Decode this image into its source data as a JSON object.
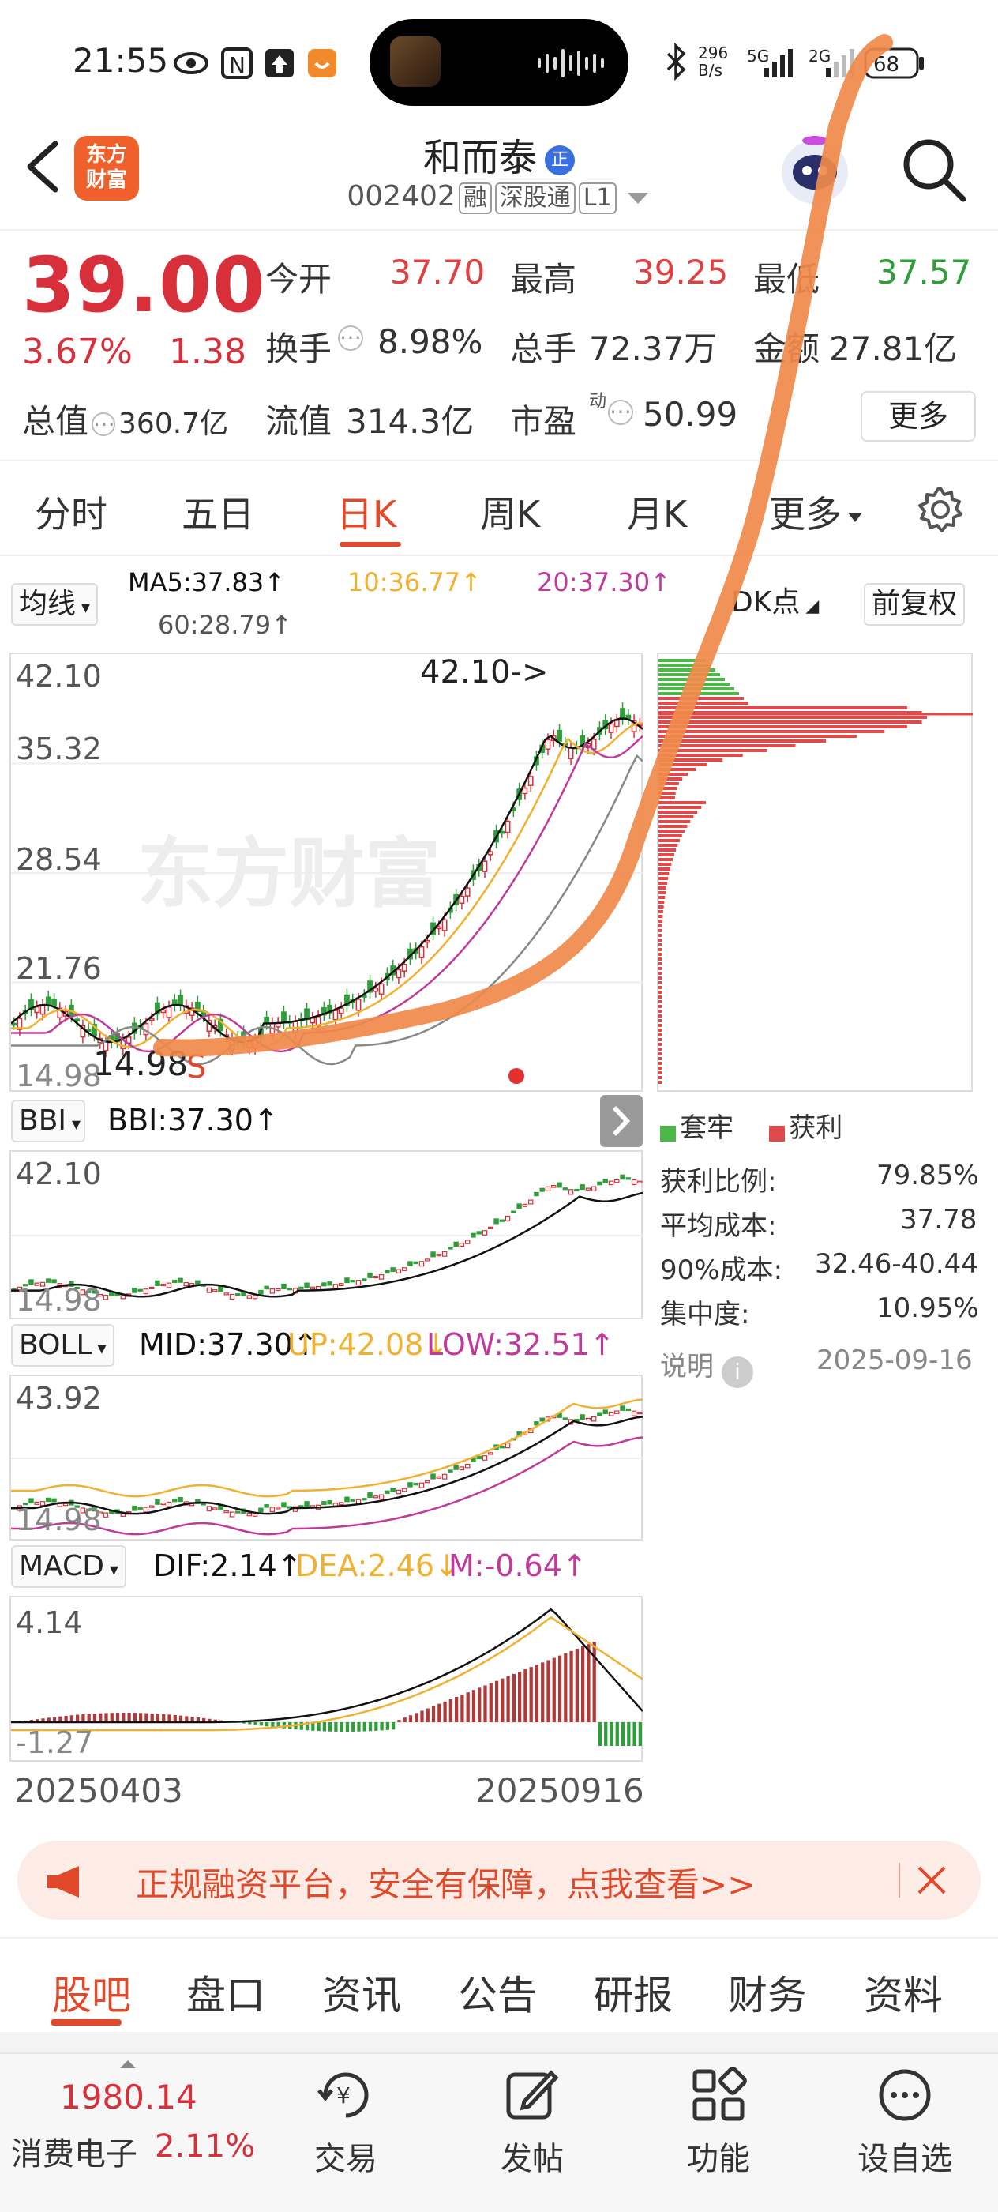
{
  "status_bar": {
    "time": "21:55",
    "net_speed_top": "296",
    "net_speed_bottom": "B/s",
    "signal_1": "5G",
    "signal_2": "2G",
    "battery": "68"
  },
  "header": {
    "stock_name": "和而泰",
    "badge": "正",
    "code": "002402",
    "tags": [
      "融",
      "深股通",
      "L1"
    ],
    "logo_line1": "东方",
    "logo_line2": "财富"
  },
  "quote": {
    "price": "39.00",
    "change_pct": "3.67%",
    "change_amt": "1.38",
    "open_label": "今开",
    "open": "37.70",
    "high_label": "最高",
    "high": "39.25",
    "low_label": "最低",
    "low": "37.57",
    "turnover_label": "换手",
    "turnover": "8.98%",
    "volume_label": "总手",
    "volume": "72.37万",
    "amount_label": "金额",
    "amount": "27.81亿",
    "mktcap_label": "总值",
    "mktcap": "360.7亿",
    "float_label": "流值",
    "float": "314.3亿",
    "pe_label": "市盈",
    "pe_sup": "动",
    "pe": "50.99",
    "more_label": "更多"
  },
  "period_tabs": [
    "分时",
    "五日",
    "日K",
    "周K",
    "月K",
    "更多"
  ],
  "active_period": "日K",
  "ma_row": {
    "selector": "均线",
    "ma5": "MA5:37.83↑",
    "ma10": "10:36.77↑",
    "ma20": "20:37.30↑",
    "ma60": "60:28.79↑",
    "dk_label": "DK点",
    "adj_label": "前复权"
  },
  "main_chart": {
    "y_labels": [
      "42.10",
      "35.32",
      "28.54",
      "21.76",
      "14.98"
    ],
    "max_label": "42.10->",
    "min_label": "14.98",
    "sell_marker": "S",
    "watermark": "东方财富"
  },
  "bbi": {
    "selector": "BBI",
    "value": "BBI:37.30↑",
    "y_top": "42.10",
    "y_bottom": "14.98"
  },
  "boll": {
    "selector": "BOLL",
    "mid": "MID:37.30↑",
    "up": "UP:42.08↓",
    "low": "LOW:32.51↑",
    "y_top": "43.92",
    "y_bottom": "14.98"
  },
  "macd": {
    "selector": "MACD",
    "dif": "DIF:2.14↑",
    "dea": "DEA:2.46↓",
    "m": "M:-0.64↑",
    "y_top": "4.14",
    "y_bottom": "-1.27"
  },
  "x_axis": {
    "start": "20250403",
    "end": "20250916"
  },
  "chip": {
    "legend_trapped": "套牢",
    "legend_profit": "获利",
    "rows": [
      {
        "label": "获利比例:",
        "value": "79.85%"
      },
      {
        "label": "平均成本:",
        "value": "37.78"
      },
      {
        "label": "90%成本:",
        "value": "32.46-40.44"
      },
      {
        "label": "集中度:",
        "value": "10.95%"
      }
    ],
    "note_label": "说明",
    "date": "2025-09-16"
  },
  "banner": {
    "text": "正规融资平台，安全有保障，点我查看>>"
  },
  "bottom_tabs": [
    "股吧",
    "盘口",
    "资讯",
    "公告",
    "研报",
    "财务",
    "资料"
  ],
  "active_bottom_tab": "股吧",
  "dock": {
    "index_value": "1980.14",
    "sector_name": "消费电子",
    "sector_pct": "2.11%",
    "items": [
      "交易",
      "发帖",
      "功能",
      "设自选"
    ]
  },
  "colors": {
    "up": "#d8303a",
    "down": "#2e9e3a",
    "accent": "#e04a2a",
    "ma5": "#111111",
    "ma10": "#f0b030",
    "ma20": "#c03a9c",
    "ma60": "#888888",
    "annotation": "#f08a4a"
  }
}
